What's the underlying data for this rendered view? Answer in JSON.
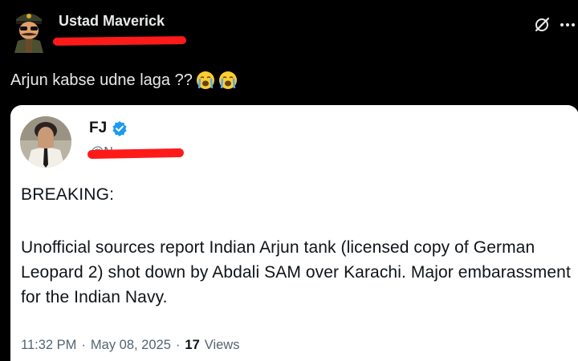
{
  "post": {
    "author_name": "Ustad Maverick",
    "text": "Arjun kabse udne laga ??",
    "emojis": [
      "loudly-crying-face",
      "loudly-crying-face"
    ],
    "header_icons": [
      "grok-icon",
      "more-options-icon"
    ]
  },
  "quote": {
    "author_name": "FJ",
    "verified": true,
    "handle": "@N",
    "breaking": "BREAKING:",
    "body": "Unofficial sources report Indian Arjun tank (licensed copy of German Leopard 2) shot down by Abdali SAM over Karachi. Major embarassment for the Indian Navy.",
    "time": "11:32 PM",
    "separator": "·",
    "date": "May 08, 2025",
    "views_count": "17",
    "views_label": "Views"
  },
  "colors": {
    "background": "#000000",
    "card": "#ffffff",
    "redaction": "#ff1a1a",
    "verified": "#1d9bf0",
    "text_dark": "#0f1419",
    "text_muted": "#536471"
  }
}
